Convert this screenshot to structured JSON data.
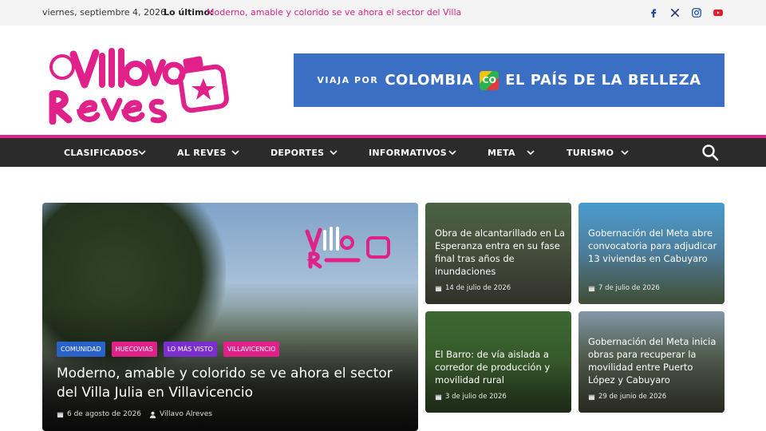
{
  "topbar": {
    "date": "viernes, septiembre 4, 2026",
    "latest_label": "Lo último:",
    "latest_link": "Moderno, amable y colorido se ve ahora el sector del Villa",
    "social": [
      "facebook-icon",
      "x-icon",
      "instagram-icon",
      "youtube-icon"
    ]
  },
  "banner": {
    "small": "VIAJA POR",
    "big_1": "COLOMBIA",
    "co": "CO",
    "big_2": "EL PAÍS DE LA BELLEZA"
  },
  "nav": {
    "items": [
      "CLASIFICADOS",
      "AL REVES",
      "DEPORTES",
      "INFORMATIVOS",
      "META",
      "TURISMO"
    ]
  },
  "featured": {
    "categories": [
      {
        "label": "COMUNIDAD",
        "color": "#2a62c9"
      },
      {
        "label": "HUECOVIAS",
        "color": "#e0218a"
      },
      {
        "label": "LO MÁS VISTO",
        "color": "#7b2fcf"
      },
      {
        "label": "VILLAVICENCIO",
        "color": "#e0218a"
      }
    ],
    "title": "Moderno, amable y colorido se ve ahora el sector del Villa Julia en Villavicencio",
    "date": "6 de agosto de 2026",
    "author": "Villavo Alreves"
  },
  "cards": [
    {
      "title": "Obra de alcantarillado en La Esperanza entra en su fase final tras años de inundaciones",
      "date": "14 de julio de 2026"
    },
    {
      "title": "Gobernación del Meta abre convocatoria para adjudicar 13 viviendas en Cabuyaro",
      "date": "7 de julio de 2026"
    },
    {
      "title": "El Barro: de vía aislada a corredor de producción y movilidad rural",
      "date": "3 de julio de 2026"
    },
    {
      "title": "Gobernación del Meta inicia obras para recuperar la movilidad entre Puerto López y Cabuyaro",
      "date": "29 de junio de 2026"
    }
  ],
  "colors": {
    "accent": "#e0218a",
    "nav_bg": "#2b2b2b",
    "banner_bg": "#3b6fc4"
  }
}
